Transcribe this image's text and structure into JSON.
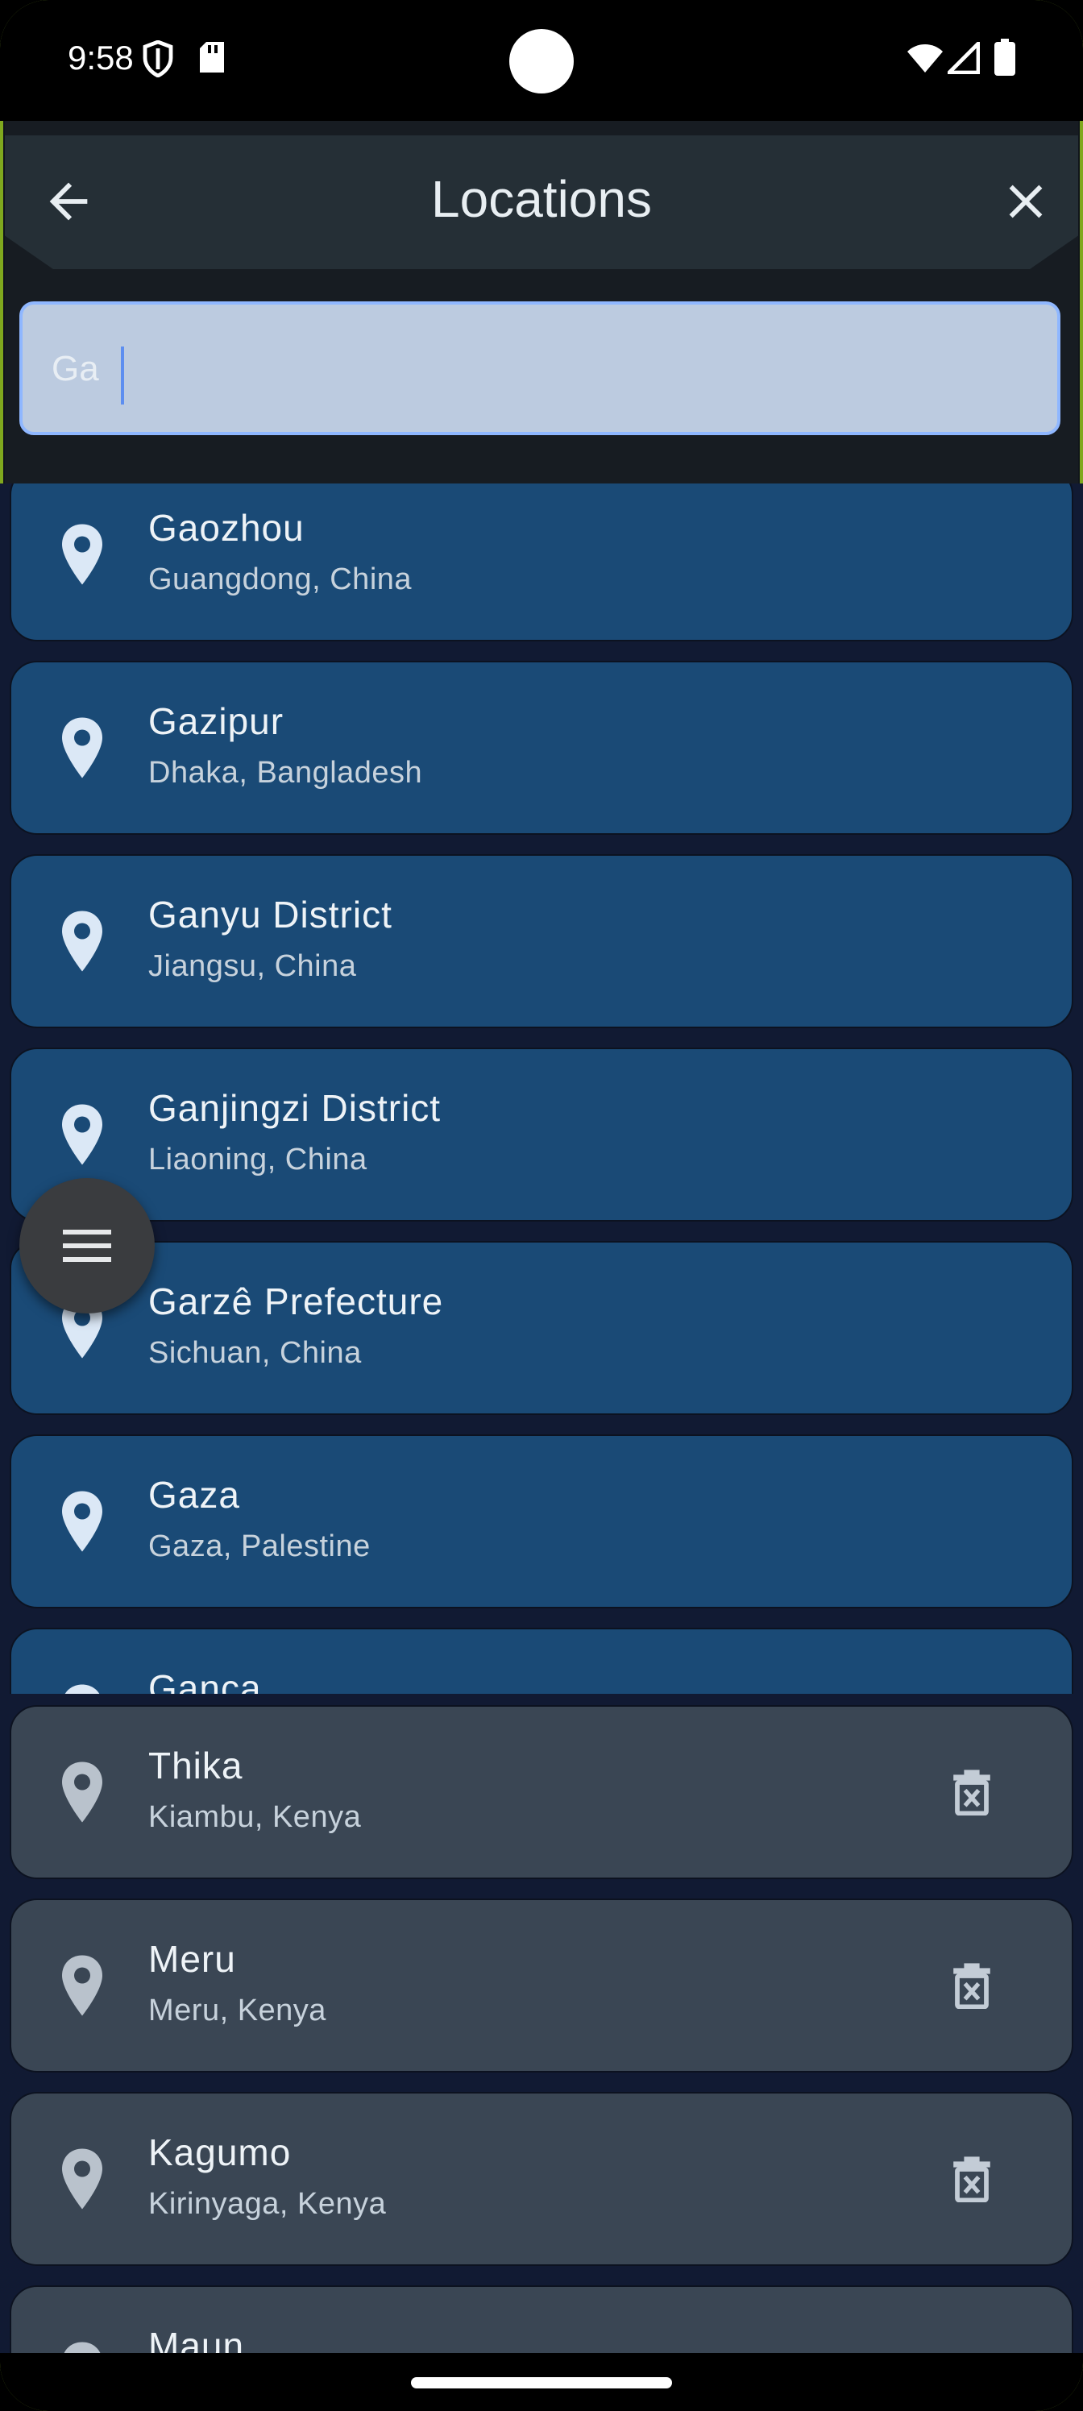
{
  "status_bar": {
    "time": "9:58"
  },
  "app_bar": {
    "title": "Locations"
  },
  "search": {
    "value": "Ga",
    "placeholder": ""
  },
  "results": [
    {
      "name": "Gaozhou",
      "region": "Guangdong, China"
    },
    {
      "name": "Gazipur",
      "region": "Dhaka, Bangladesh"
    },
    {
      "name": "Ganyu District",
      "region": "Jiangsu, China"
    },
    {
      "name": "Ganjingzi District",
      "region": "Liaoning, China"
    },
    {
      "name": "Garzê Prefecture",
      "region": "Sichuan, China"
    },
    {
      "name": "Gaza",
      "region": "Gaza, Palestine"
    },
    {
      "name": "Ganca",
      "region": ""
    }
  ],
  "saved_locations": [
    {
      "name": "Thika",
      "region": "Kiambu, Kenya"
    },
    {
      "name": "Meru",
      "region": "Meru, Kenya"
    },
    {
      "name": "Kagumo",
      "region": "Kirinyaga, Kenya"
    },
    {
      "name": "Maun",
      "region": ""
    }
  ],
  "colors": {
    "result_card": "#1a4a76",
    "saved_card": "#3a4654",
    "search_field": "#bccbe0",
    "app_bar": "#252f36"
  },
  "icons": {
    "back": "arrow-back-icon",
    "close": "close-icon",
    "location": "location-pin-icon",
    "delete": "delete-icon",
    "menu": "menu-icon"
  }
}
